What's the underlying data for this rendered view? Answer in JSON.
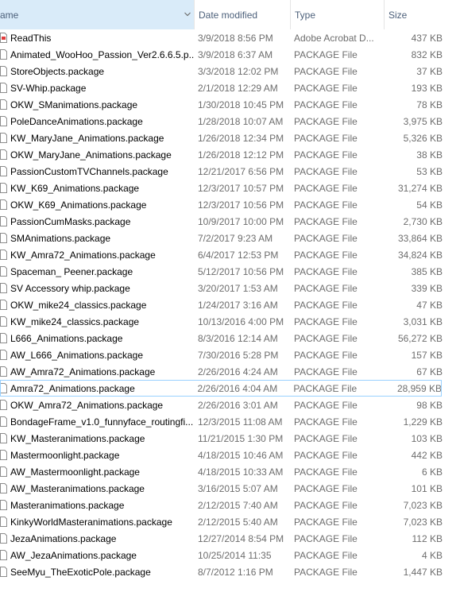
{
  "columns": {
    "name": "ame",
    "date": "Date modified",
    "type": "Type",
    "size": "Size"
  },
  "files": [
    {
      "name": "ReadThis",
      "date": "3/9/2018 8:56 PM",
      "type": "Adobe Acrobat D...",
      "size": "437 KB",
      "icon": "pdf-icon"
    },
    {
      "name": "Animated_WooHoo_Passion_Ver2.6.6.5.p...",
      "date": "3/9/2018 6:37 AM",
      "type": "PACKAGE File",
      "size": "832 KB",
      "icon": "file-icon"
    },
    {
      "name": "StoreObjects.package",
      "date": "3/3/2018 12:02 PM",
      "type": "PACKAGE File",
      "size": "37 KB",
      "icon": "file-icon"
    },
    {
      "name": "SV-Whip.package",
      "date": "2/1/2018 12:29 AM",
      "type": "PACKAGE File",
      "size": "193 KB",
      "icon": "file-icon"
    },
    {
      "name": "OKW_SManimations.package",
      "date": "1/30/2018 10:45 PM",
      "type": "PACKAGE File",
      "size": "78 KB",
      "icon": "file-icon"
    },
    {
      "name": "PoleDanceAnimations.package",
      "date": "1/28/2018 10:07 AM",
      "type": "PACKAGE File",
      "size": "3,975 KB",
      "icon": "file-icon"
    },
    {
      "name": "KW_MaryJane_Animations.package",
      "date": "1/26/2018 12:34 PM",
      "type": "PACKAGE File",
      "size": "5,326 KB",
      "icon": "file-icon"
    },
    {
      "name": "OKW_MaryJane_Animations.package",
      "date": "1/26/2018 12:12 PM",
      "type": "PACKAGE File",
      "size": "38 KB",
      "icon": "file-icon"
    },
    {
      "name": "PassionCustomTVChannels.package",
      "date": "12/21/2017 6:56 PM",
      "type": "PACKAGE File",
      "size": "53 KB",
      "icon": "file-icon"
    },
    {
      "name": "KW_K69_Animations.package",
      "date": "12/3/2017 10:57 PM",
      "type": "PACKAGE File",
      "size": "31,274 KB",
      "icon": "file-icon"
    },
    {
      "name": "OKW_K69_Animations.package",
      "date": "12/3/2017 10:56 PM",
      "type": "PACKAGE File",
      "size": "54 KB",
      "icon": "file-icon"
    },
    {
      "name": "PassionCumMasks.package",
      "date": "10/9/2017 10:00 PM",
      "type": "PACKAGE File",
      "size": "2,730 KB",
      "icon": "file-icon"
    },
    {
      "name": "SMAnimations.package",
      "date": "7/2/2017 9:23 AM",
      "type": "PACKAGE File",
      "size": "33,864 KB",
      "icon": "file-icon"
    },
    {
      "name": "KW_Amra72_Animations.package",
      "date": "6/4/2017 12:53 PM",
      "type": "PACKAGE File",
      "size": "34,824 KB",
      "icon": "file-icon"
    },
    {
      "name": "Spaceman_ Peener.package",
      "date": "5/12/2017 10:56 PM",
      "type": "PACKAGE File",
      "size": "385 KB",
      "icon": "file-icon"
    },
    {
      "name": "SV Accessory whip.package",
      "date": "3/20/2017 1:53 AM",
      "type": "PACKAGE File",
      "size": "339 KB",
      "icon": "file-icon"
    },
    {
      "name": "OKW_mike24_classics.package",
      "date": "1/24/2017 3:16 AM",
      "type": "PACKAGE File",
      "size": "47 KB",
      "icon": "file-icon"
    },
    {
      "name": "KW_mike24_classics.package",
      "date": "10/13/2016 4:00 PM",
      "type": "PACKAGE File",
      "size": "3,031 KB",
      "icon": "file-icon"
    },
    {
      "name": "L666_Animations.package",
      "date": "8/3/2016 12:14 AM",
      "type": "PACKAGE File",
      "size": "56,272 KB",
      "icon": "file-icon"
    },
    {
      "name": "AW_L666_Animations.package",
      "date": "7/30/2016 5:28 PM",
      "type": "PACKAGE File",
      "size": "157 KB",
      "icon": "file-icon"
    },
    {
      "name": "AW_Amra72_Animations.package",
      "date": "2/26/2016 4:24 AM",
      "type": "PACKAGE File",
      "size": "67 KB",
      "icon": "file-icon"
    },
    {
      "name": "Amra72_Animations.package",
      "date": "2/26/2016 4:04 AM",
      "type": "PACKAGE File",
      "size": "28,959 KB",
      "icon": "file-icon",
      "selected": true
    },
    {
      "name": "OKW_Amra72_Animations.package",
      "date": "2/26/2016 3:01 AM",
      "type": "PACKAGE File",
      "size": "98 KB",
      "icon": "file-icon"
    },
    {
      "name": "BondageFrame_v1.0_funnyface_routingfi...",
      "date": "12/3/2015 11:08 AM",
      "type": "PACKAGE File",
      "size": "1,229 KB",
      "icon": "file-icon"
    },
    {
      "name": "KW_Masteranimations.package",
      "date": "11/21/2015 1:30 PM",
      "type": "PACKAGE File",
      "size": "103 KB",
      "icon": "file-icon"
    },
    {
      "name": "Mastermoonlight.package",
      "date": "4/18/2015 10:46 AM",
      "type": "PACKAGE File",
      "size": "442 KB",
      "icon": "file-icon"
    },
    {
      "name": "AW_Mastermoonlight.package",
      "date": "4/18/2015 10:33 AM",
      "type": "PACKAGE File",
      "size": "6 KB",
      "icon": "file-icon"
    },
    {
      "name": "AW_Masteranimations.package",
      "date": "3/16/2015 5:07 AM",
      "type": "PACKAGE File",
      "size": "101 KB",
      "icon": "file-icon"
    },
    {
      "name": "Masteranimations.package",
      "date": "2/12/2015 7:40 AM",
      "type": "PACKAGE File",
      "size": "7,023 KB",
      "icon": "file-icon"
    },
    {
      "name": "KinkyWorldMasteranimations.package",
      "date": "2/12/2015 5:40 AM",
      "type": "PACKAGE File",
      "size": "7,023 KB",
      "icon": "file-icon"
    },
    {
      "name": "JezaAnimations.package",
      "date": "12/27/2014 8:54 PM",
      "type": "PACKAGE File",
      "size": "112 KB",
      "icon": "file-icon"
    },
    {
      "name": "AW_JezaAnimations.package",
      "date": "10/25/2014 11:35",
      "type": "PACKAGE File",
      "size": "4 KB",
      "icon": "file-icon"
    },
    {
      "name": "SeeMyu_TheExoticPole.package",
      "date": "8/7/2012 1:16 PM",
      "type": "PACKAGE File",
      "size": "1,447 KB",
      "icon": "file-icon"
    }
  ],
  "colors": {
    "header_selected_bg": "#d9ebf9",
    "header_text": "#4c607a",
    "secondary_text": "#6d6d6d",
    "selection_border": "#99d1ff",
    "pdf_icon_accent": "#e03b3b"
  }
}
